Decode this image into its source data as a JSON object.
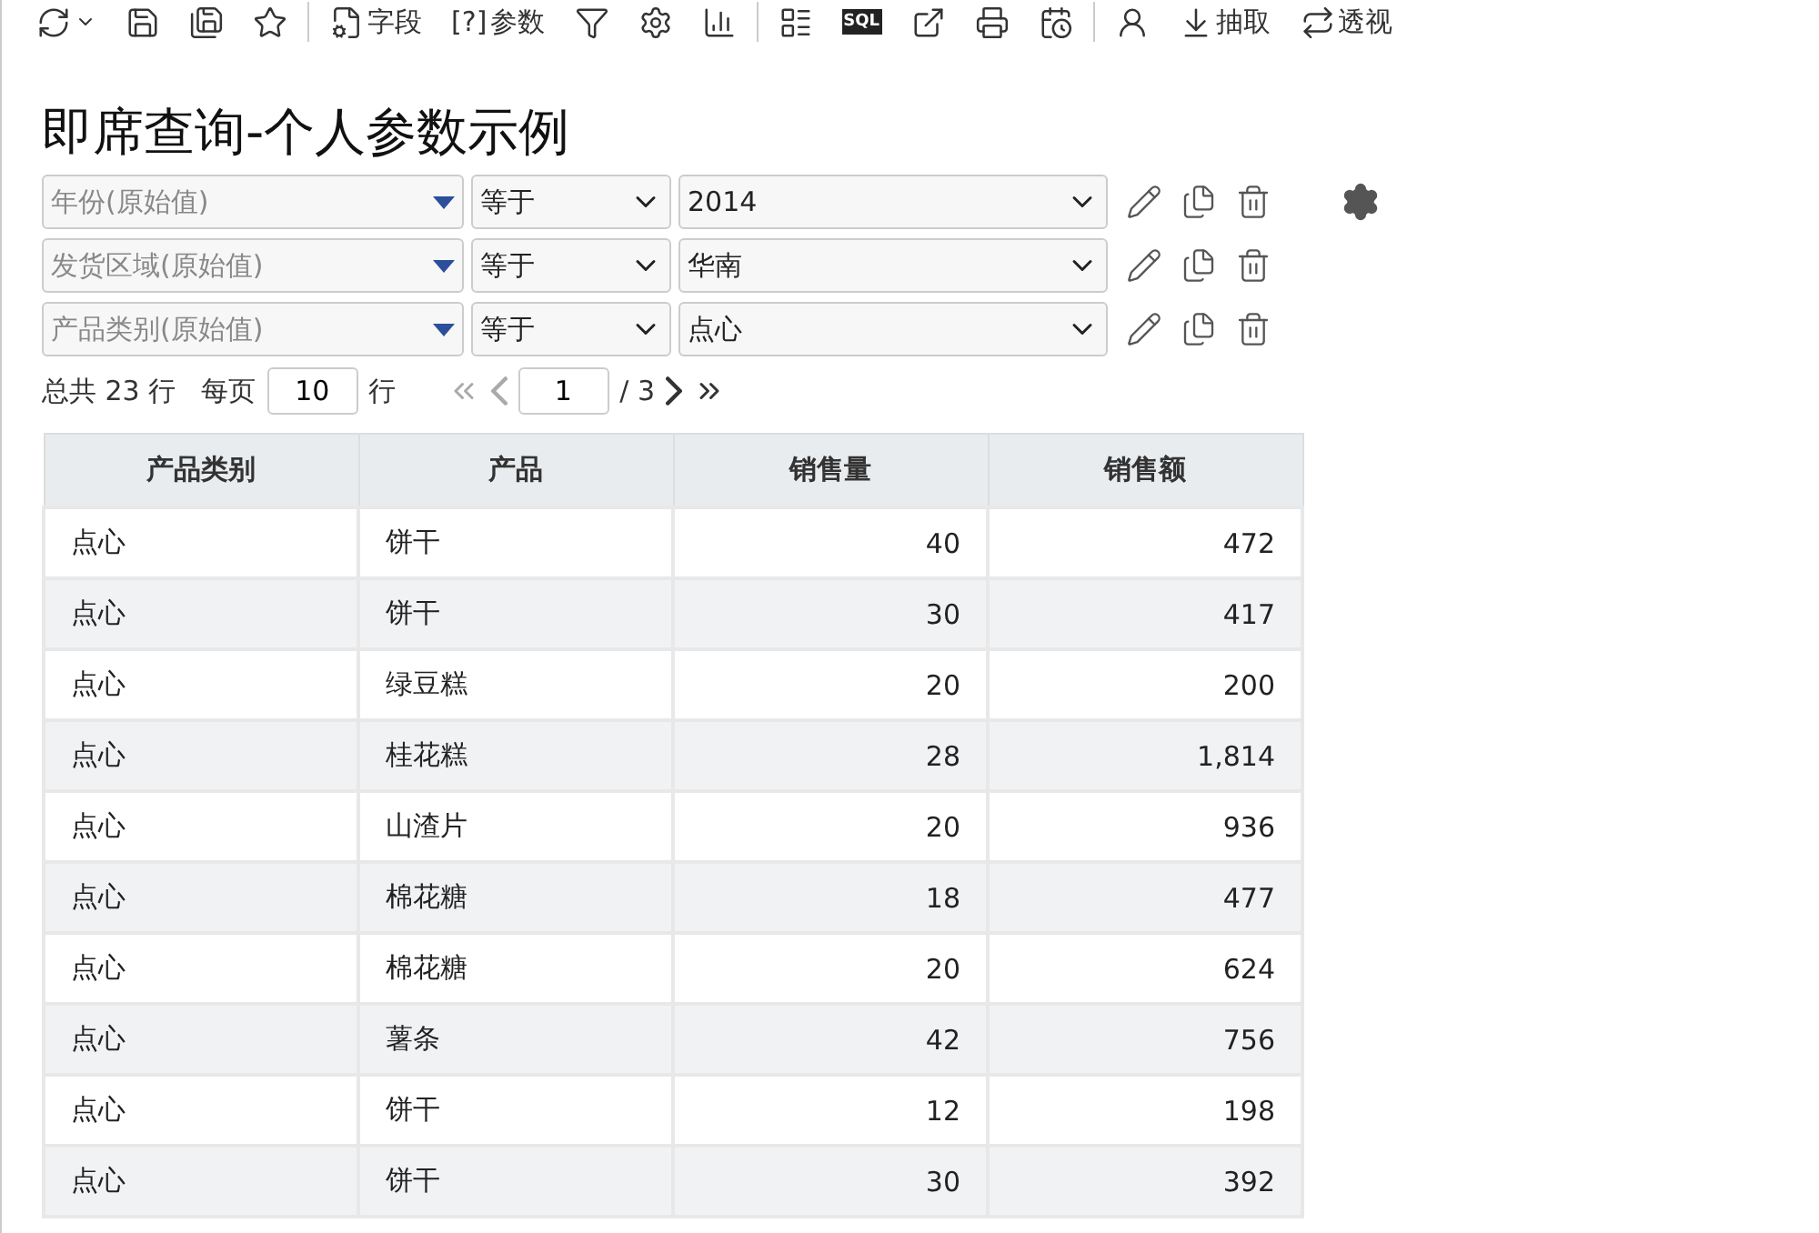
{
  "toolbar": [
    {
      "kind": "refresh"
    },
    {
      "kind": "save"
    },
    {
      "kind": "save-as"
    },
    {
      "kind": "favorite"
    },
    {
      "kind": "divider"
    },
    {
      "kind": "field",
      "label": "字段"
    },
    {
      "kind": "param",
      "glyph": "[?]",
      "label": "参数"
    },
    {
      "kind": "filter"
    },
    {
      "kind": "settings"
    },
    {
      "kind": "chart"
    },
    {
      "kind": "divider"
    },
    {
      "kind": "form"
    },
    {
      "kind": "sql",
      "glyph": "SQL"
    },
    {
      "kind": "export"
    },
    {
      "kind": "print"
    },
    {
      "kind": "schedule"
    },
    {
      "kind": "divider"
    },
    {
      "kind": "user-param"
    },
    {
      "kind": "extract",
      "label": "抽取"
    },
    {
      "kind": "pivot",
      "label": "透视"
    }
  ],
  "title": "即席查询-个人参数示例",
  "filters": [
    {
      "field": "年份(原始值)",
      "operator": "等于",
      "value": "2014"
    },
    {
      "field": "发货区域(原始值)",
      "operator": "等于",
      "value": "华南"
    },
    {
      "field": "产品类别(原始值)",
      "operator": "等于",
      "value": "点心"
    }
  ],
  "pager": {
    "total": "总共 23 行",
    "per_page_label": "每页",
    "per_page": "10",
    "rows_unit": "行",
    "page": "1",
    "pages": "/ 3",
    "first_disabled": true,
    "prev_disabled": true,
    "next_disabled": false,
    "last_disabled": false
  },
  "table": {
    "columns": [
      "产品类别",
      "产品",
      "销售量",
      "销售额"
    ],
    "rows": [
      [
        "点心",
        "饼干",
        "40",
        "472"
      ],
      [
        "点心",
        "饼干",
        "30",
        "417"
      ],
      [
        "点心",
        "绿豆糕",
        "20",
        "200"
      ],
      [
        "点心",
        "桂花糕",
        "28",
        "1,814"
      ],
      [
        "点心",
        "山渣片",
        "20",
        "936"
      ],
      [
        "点心",
        "棉花糖",
        "18",
        "477"
      ],
      [
        "点心",
        "棉花糖",
        "20",
        "624"
      ],
      [
        "点心",
        "薯条",
        "42",
        "756"
      ],
      [
        "点心",
        "饼干",
        "12",
        "198"
      ],
      [
        "点心",
        "饼干",
        "30",
        "392"
      ]
    ]
  }
}
